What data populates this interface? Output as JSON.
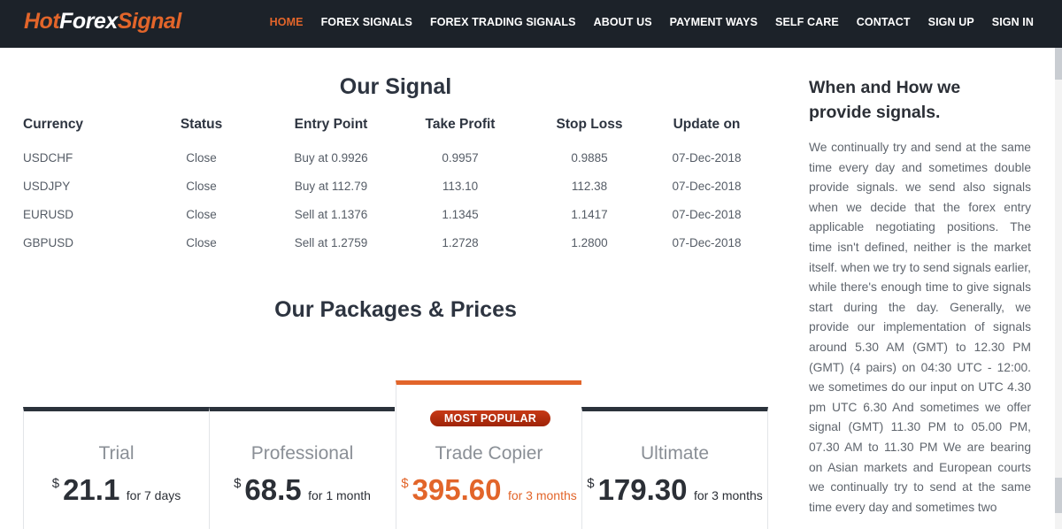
{
  "brand": {
    "part1": "Hot",
    "part2": "Forex",
    "part3": "Signal"
  },
  "nav": [
    {
      "label": "HOME",
      "active": true
    },
    {
      "label": "FOREX SIGNALS",
      "active": false
    },
    {
      "label": "FOREX TRADING SIGNALS",
      "active": false
    },
    {
      "label": "ABOUT US",
      "active": false
    },
    {
      "label": "PAYMENT WAYS",
      "active": false
    },
    {
      "label": "SELF CARE",
      "active": false
    },
    {
      "label": "CONTACT",
      "active": false
    },
    {
      "label": "SIGN UP",
      "active": false
    },
    {
      "label": "SIGN IN",
      "active": false
    }
  ],
  "signals": {
    "title": "Our Signal",
    "headers": [
      "Currency",
      "Status",
      "Entry Point",
      "Take Profit",
      "Stop Loss",
      "Update on"
    ],
    "rows": [
      [
        "USDCHF",
        "Close",
        "Buy at 0.9926",
        "0.9957",
        "0.9885",
        "07-Dec-2018"
      ],
      [
        "USDJPY",
        "Close",
        "Buy at 112.79",
        "113.10",
        "112.38",
        "07-Dec-2018"
      ],
      [
        "EURUSD",
        "Close",
        "Sell at 1.1376",
        "1.1345",
        "1.1417",
        "07-Dec-2018"
      ],
      [
        "GBPUSD",
        "Close",
        "Sell at 1.2759",
        "1.2728",
        "1.2800",
        "07-Dec-2018"
      ]
    ]
  },
  "packages": {
    "title": "Our Packages & Prices",
    "popular_badge": "MOST POPULAR",
    "plans": [
      {
        "name": "Trial",
        "currency": "$",
        "amount": "21.1",
        "period": "for 7 days"
      },
      {
        "name": "Professional",
        "currency": "$",
        "amount": "68.5",
        "period": "for 1 month"
      },
      {
        "name": "Trade Copier",
        "currency": "$",
        "amount": "395.60",
        "period": "for 3 months"
      },
      {
        "name": "Ultimate",
        "currency": "$",
        "amount": "179.30",
        "period": "for 3 months"
      }
    ]
  },
  "sidebar": {
    "title_line1": "When and How we",
    "title_line2": "provide signals.",
    "text": "We continually try and send at the same time every day and sometimes double provide signals. we send also signals when we decide that the forex entry applicable negotiating positions. The time isn't defined, neither is the market itself. when we try to send signals earlier, while there's enough time to give signals start during the day. Generally, we provide our implementation of signals around 5.30 AM (GMT) to 12.30 PM (GMT) (4 pairs) on 04:30 UTC - 12:00. we sometimes do our input on UTC 4.30 pm UTC 6.30 And sometimes we offer signal (GMT) 11.30 PM to 05.00 PM, 07.30 AM to 11.30 PM We are bearing on Asian markets and European courts we continually try to send at the same time every day and sometimes two"
  },
  "colors": {
    "accent": "#e2652a",
    "navbar": "#1c2229",
    "badge": "#b02e0e"
  }
}
